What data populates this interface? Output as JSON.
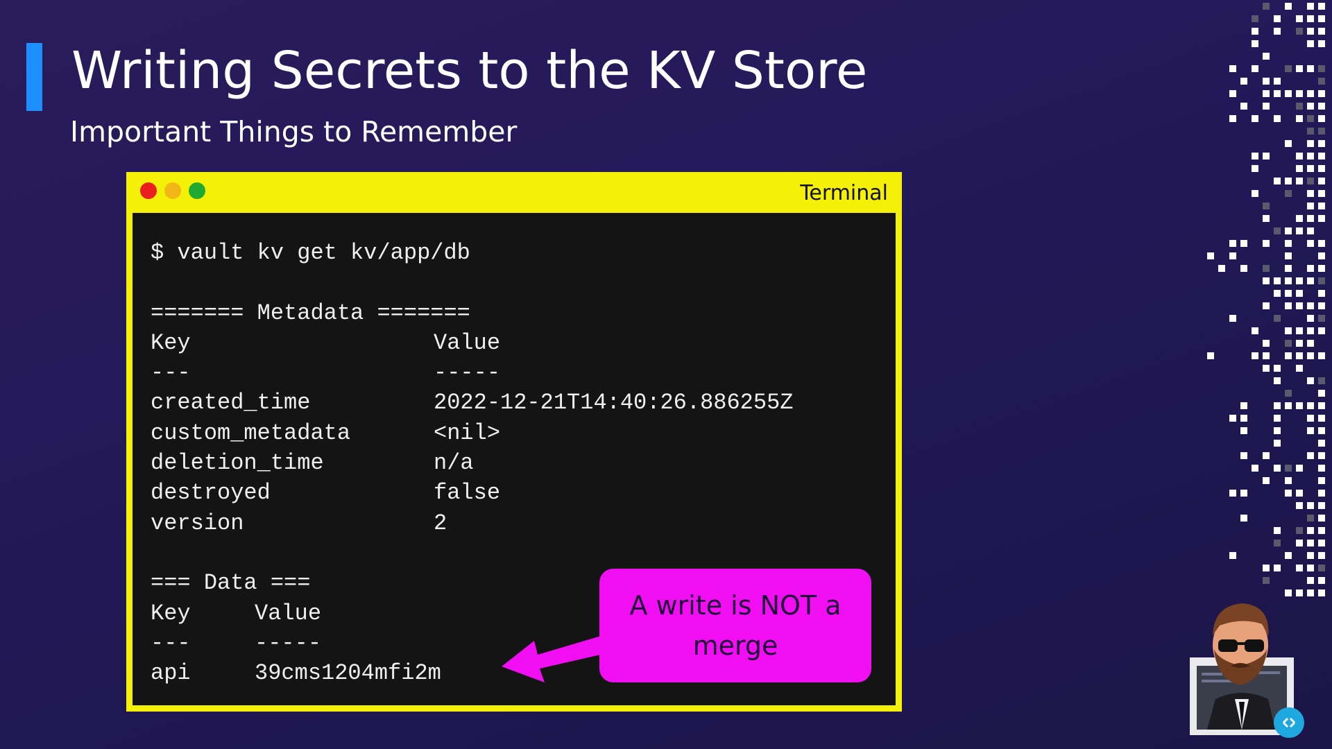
{
  "slide": {
    "title": "Writing Secrets to the KV Store",
    "subtitle": "Important Things to Remember",
    "accent_color": "#1e8fff"
  },
  "terminal": {
    "window_title": "Terminal",
    "frame_color": "#f4f007",
    "command": "$ vault kv get kv/app/db",
    "metadata_header": "======= Metadata =======",
    "metadata_columns": {
      "key": "Key",
      "value": "Value"
    },
    "metadata_separators": {
      "key": "---",
      "value": "-----"
    },
    "metadata_rows": [
      {
        "key": "created_time",
        "value": "2022-12-21T14:40:26.886255Z"
      },
      {
        "key": "custom_metadata",
        "value": "<nil>"
      },
      {
        "key": "deletion_time",
        "value": "n/a"
      },
      {
        "key": "destroyed",
        "value": "false"
      },
      {
        "key": "version",
        "value": "2"
      }
    ],
    "data_header": "=== Data ===",
    "data_columns": {
      "key": "Key",
      "value": "Value"
    },
    "data_separators": {
      "key": "---",
      "value": "-----"
    },
    "data_rows": [
      {
        "key": "api",
        "value": "39cms1204mfi2m"
      }
    ]
  },
  "callout": {
    "text": "A write is NOT a merge",
    "color": "#f20ef2"
  }
}
